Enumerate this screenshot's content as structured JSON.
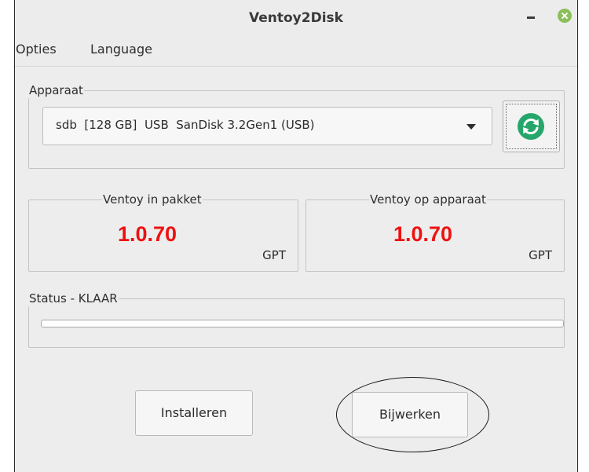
{
  "window": {
    "title": "Ventoy2Disk"
  },
  "titlebar": {
    "minimize_icon": "minimize-icon",
    "close_icon": "close-icon",
    "close_color": "#8bbf58"
  },
  "menubar": {
    "items": [
      {
        "label": "Opties"
      },
      {
        "label": "Language"
      }
    ]
  },
  "device": {
    "legend": "Apparaat",
    "selected": "sdb  [128 GB]  USB  SanDisk 3.2Gen1 (USB)",
    "refresh_icon": "refresh-icon",
    "refresh_color": "#26a66a"
  },
  "package": {
    "legend": "Ventoy in pakket",
    "version": "1.0.70",
    "partition_style": "GPT"
  },
  "installed": {
    "legend": "Ventoy op apparaat",
    "version": "1.0.70",
    "partition_style": "GPT"
  },
  "status": {
    "legend": "Status - KLAAR",
    "progress_percent": 0
  },
  "actions": {
    "install_label": "Installeren",
    "update_label": "Bijwerken"
  },
  "colors": {
    "version_text": "#ee1111",
    "accent": "#26a66a"
  }
}
